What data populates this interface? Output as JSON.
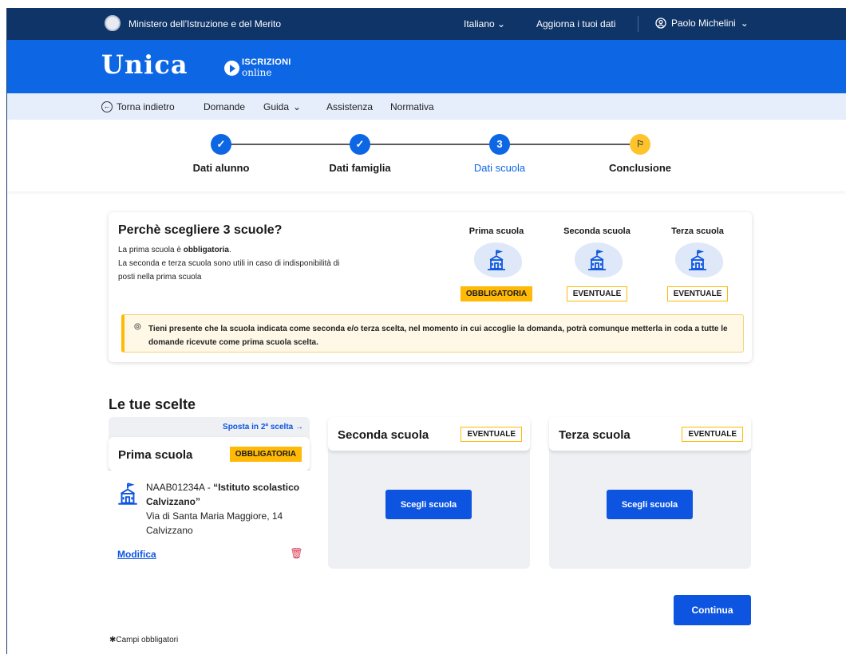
{
  "topbar": {
    "ministry": "Ministero dell'Istruzione e del Merito",
    "language": "Italiano",
    "update_data": "Aggiorna i tuoi dati",
    "user_name": "Paolo Michelini"
  },
  "brand": {
    "logo": "Unica",
    "iscrizioni_line1": "ISCRIZIONI",
    "iscrizioni_line2": "online"
  },
  "nav": {
    "back": "Torna indietro",
    "items": [
      "Domande",
      "Guida",
      "Assistenza",
      "Normativa"
    ]
  },
  "stepper": {
    "steps": [
      {
        "label": "Dati alunno",
        "status": "done"
      },
      {
        "label": "Dati famiglia",
        "status": "done"
      },
      {
        "label": "Dati scuola",
        "status": "active",
        "number": "3"
      },
      {
        "label": "Conclusione",
        "status": "pending"
      }
    ]
  },
  "info": {
    "title": "Perchè scegliere 3 scuole?",
    "line1_prefix": "La prima scuola è ",
    "line1_bold": "obbligatoria",
    "line1_suffix": ".",
    "line2": "La seconda e terza scuola sono utili in caso di indisponibilità di",
    "line3": "posti nella prima scuola",
    "schools": [
      {
        "name": "Prima scuola",
        "badge": "OBBLIGATORIA"
      },
      {
        "name": "Seconda scuola",
        "badge": "EVENTUALE"
      },
      {
        "name": "Terza scuola",
        "badge": "EVENTUALE"
      }
    ],
    "notice": "Tieni presente che la scuola indicata come seconda e/o terza scelta, nel momento in cui accoglie la domanda, potrà comunque metterla in coda a tutte le domande ricevute come prima scuola scelta."
  },
  "choices": {
    "title": "Le tue scelte",
    "first": {
      "move_link": "Sposta in 2ª scelta →",
      "name": "Prima scuola",
      "badge": "OBBLIGATORIA",
      "code": "NAAB01234A - ",
      "school_name": "“Istituto scolastico Calvizzano”",
      "address": "Via di Santa Maria Maggiore, 14",
      "city": "Calvizzano",
      "edit": "Modifica"
    },
    "second": {
      "name": "Seconda scuola",
      "badge": "EVENTUALE",
      "button": "Scegli scuola"
    },
    "third": {
      "name": "Terza scuola",
      "badge": "EVENTUALE",
      "button": "Scegli scuola"
    }
  },
  "footer": {
    "continue": "Continua",
    "required_note": "✱Campi obbligatori"
  },
  "colors": {
    "topbar": "#0f3468",
    "brand_blue": "#0d66e4",
    "nav_bg": "#e6eefb",
    "button_blue": "#0d55e0",
    "warning_yellow": "#ffb906"
  }
}
